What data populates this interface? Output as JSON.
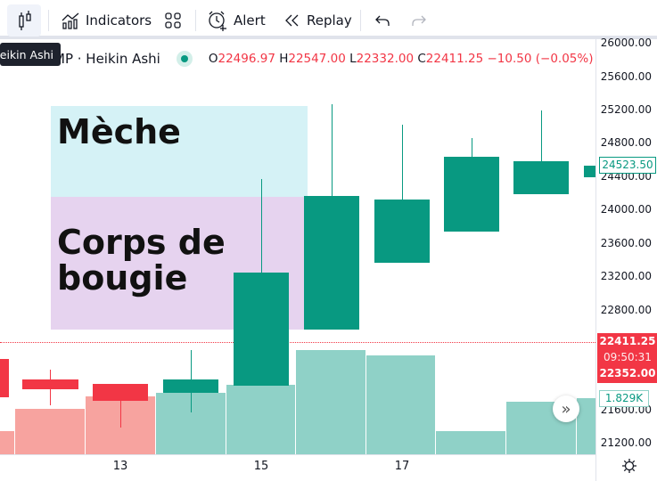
{
  "toolbar": {
    "tooltip": "Heikin Ashi",
    "indicators": "Indicators",
    "alert": "Alert",
    "replay": "Replay"
  },
  "legend": {
    "symbol": "MP · Heikin Ashi",
    "o_label": "O",
    "o": "22496.97",
    "h_label": "H",
    "h": "22547.00",
    "l_label": "L",
    "l": "22332.00",
    "c_label": "C",
    "c": "22411.25",
    "change": "−10.50 (−0.05%)"
  },
  "annotations": {
    "wick": "Mèche",
    "body": "Corps de bougie"
  },
  "price_axis": [
    "26000.00",
    "25600.00",
    "25200.00",
    "24800.00",
    "24400.00",
    "24000.00",
    "23600.00",
    "23200.00",
    "22800.00",
    "21600.00",
    "21200.00"
  ],
  "badges": {
    "last_green": "24523.50",
    "price": "22411.25",
    "countdown": "09:50:31",
    "low": "22352.00",
    "volume": "1.829K"
  },
  "time_axis": [
    "13",
    "15",
    "17"
  ],
  "colors": {
    "up": "#089981",
    "down": "#f23645",
    "vol_up": "#8fd1c7",
    "vol_down": "#f7a39f"
  }
}
